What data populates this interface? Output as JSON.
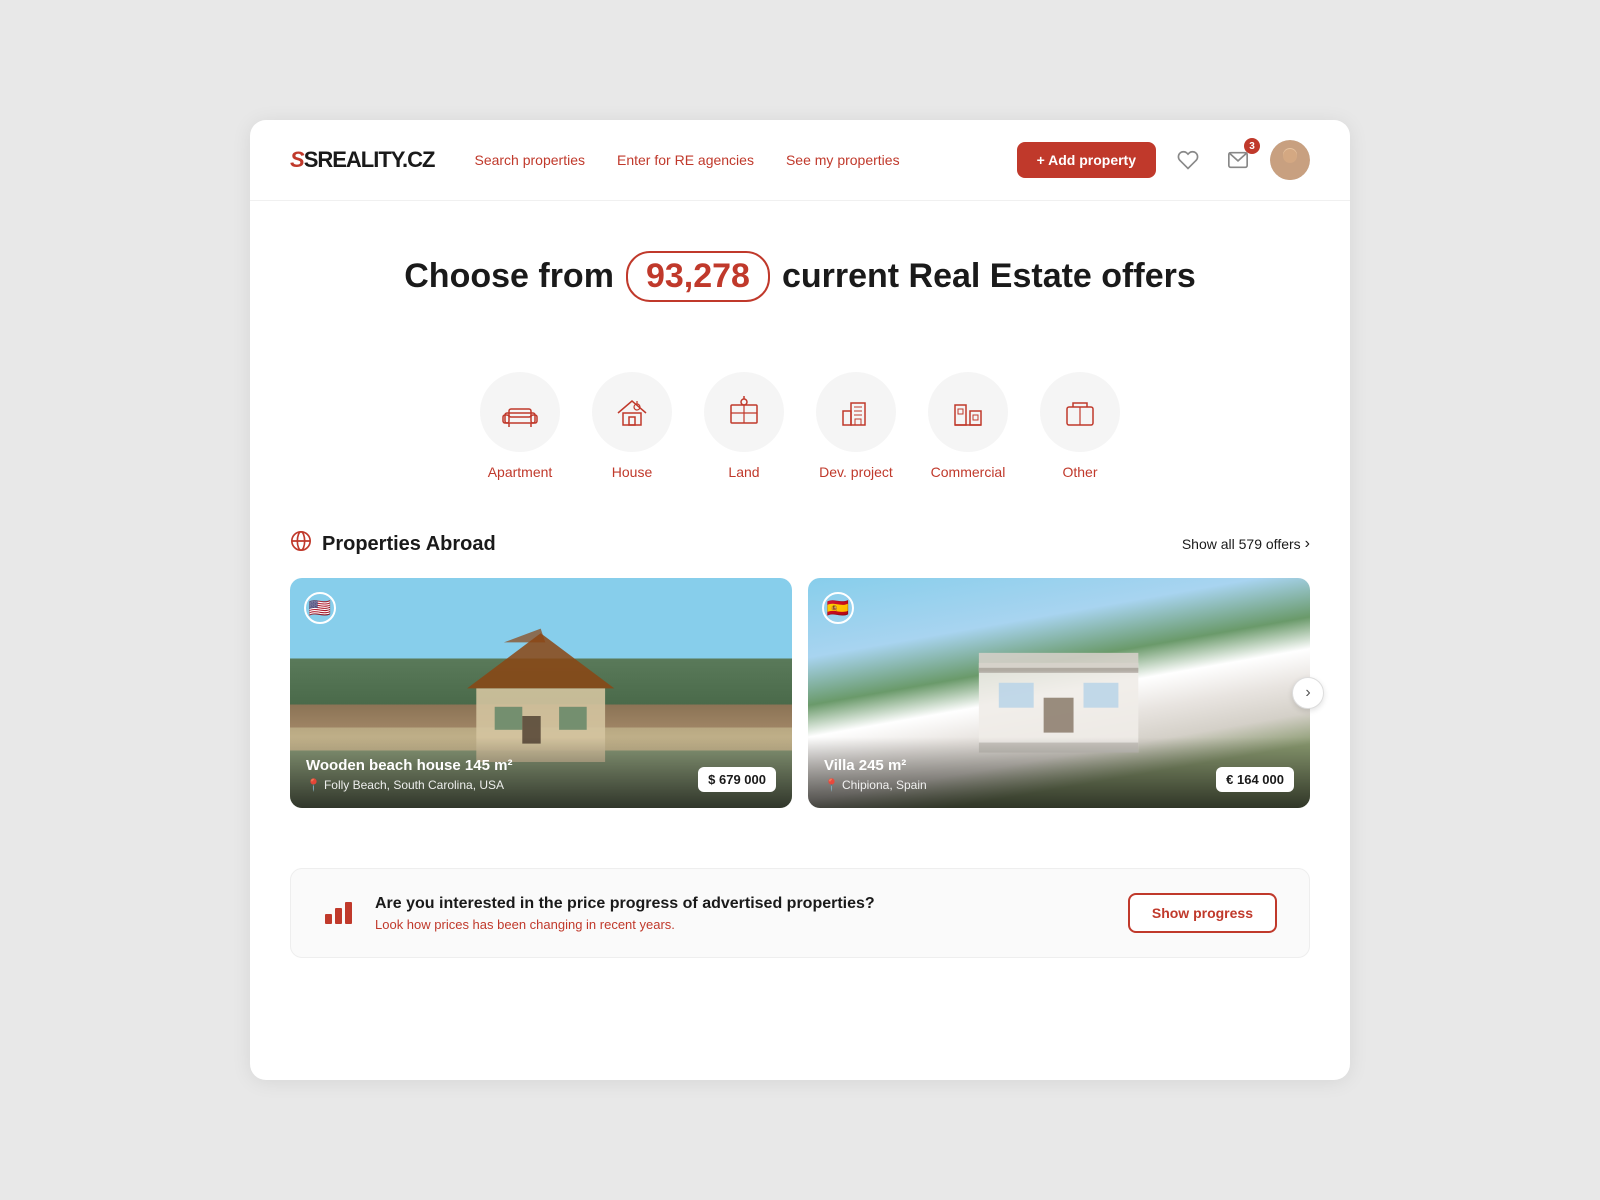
{
  "header": {
    "logo": "SREALITY.CZ",
    "nav": [
      {
        "label": "Search properties",
        "id": "search"
      },
      {
        "label": "Enter for RE agencies",
        "id": "agencies"
      },
      {
        "label": "See my properties",
        "id": "my-properties"
      }
    ],
    "add_property_label": "+ Add property",
    "message_badge": "3"
  },
  "hero": {
    "prefix": "Choose from",
    "count": "93,278",
    "suffix": "current Real Estate offers"
  },
  "categories": [
    {
      "id": "apartment",
      "label": "Apartment",
      "icon": "sofa"
    },
    {
      "id": "house",
      "label": "House",
      "icon": "house"
    },
    {
      "id": "land",
      "label": "Land",
      "icon": "land"
    },
    {
      "id": "dev-project",
      "label": "Dev. project",
      "icon": "devproject"
    },
    {
      "id": "commercial",
      "label": "Commercial",
      "icon": "commercial"
    },
    {
      "id": "other",
      "label": "Other",
      "icon": "other"
    }
  ],
  "properties_abroad": {
    "section_title": "Properties Abroad",
    "show_all_label": "Show all 579 offers",
    "cards": [
      {
        "id": "card-1",
        "title": "Wooden beach house 145 m²",
        "location": "Folly Beach, South Carolina, USA",
        "price": "$ 679 000",
        "flag": "🇺🇸"
      },
      {
        "id": "card-2",
        "title": "Villa 245 m²",
        "location": "Chipiona, Spain",
        "price": "€ 164 000",
        "flag": "🇪🇸"
      }
    ]
  },
  "progress_banner": {
    "title": "Are you interested in the price progress of advertised properties?",
    "subtitle": "Look how prices has been changing in recent years.",
    "button_label": "Show progress"
  }
}
